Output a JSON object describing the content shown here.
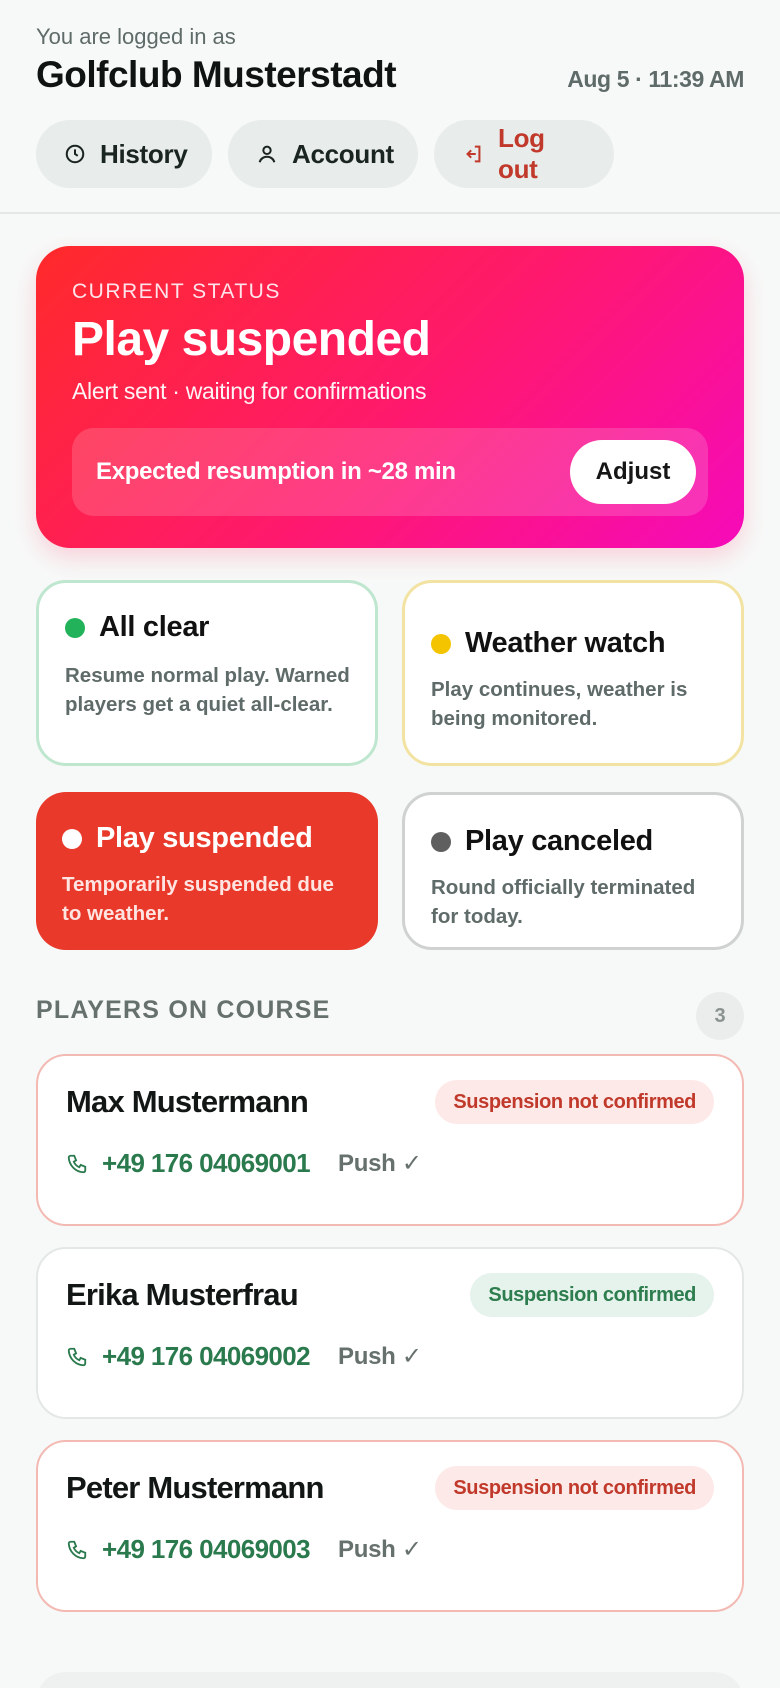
{
  "header": {
    "logged_in_label": "You are logged in as",
    "club_name": "Golfclub Musterstadt",
    "datetime": "Aug 5 · 11:39 AM",
    "nav": {
      "history": "History",
      "account": "Account",
      "logout": "Log out"
    }
  },
  "status": {
    "kicker": "CURRENT STATUS",
    "title": "Play suspended",
    "subtitle": "Alert sent · waiting for confirmations",
    "resumption": "Expected resumption in ~28 min",
    "adjust_label": "Adjust"
  },
  "options": {
    "all_clear": {
      "title": "All clear",
      "desc": "Resume normal play. Warned players get a quiet all-clear.",
      "color": "#22b35a"
    },
    "weather_watch": {
      "title": "Weather watch",
      "desc": "Play continues, weather is being monitored.",
      "color": "#f5c400"
    },
    "suspended": {
      "title": "Play suspended",
      "desc": "Temporarily suspended due to weather.",
      "color": "#e8392a"
    },
    "canceled": {
      "title": "Play canceled",
      "desc": "Round officially terminated for today.",
      "color": "#5f5f5f"
    }
  },
  "players": {
    "label": "PLAYERS ON COURSE",
    "count": "3",
    "list": [
      {
        "name": "Max Mustermann",
        "status": "Suspension not confirmed",
        "phone": "+49 176 04069001",
        "push": "Push ✓"
      },
      {
        "name": "Erika Musterfrau",
        "status": "Suspension confirmed",
        "phone": "+49 176 04069002",
        "push": "Push ✓"
      },
      {
        "name": "Peter Mustermann",
        "status": "Suspension not confirmed",
        "phone": "+49 176 04069003",
        "push": "Push ✓"
      }
    ]
  },
  "colors": {
    "accent_green": "#2a7a4e",
    "danger": "#c0392b",
    "status_gradient_start": "#ff2a2a",
    "status_gradient_end": "#f50aba"
  }
}
